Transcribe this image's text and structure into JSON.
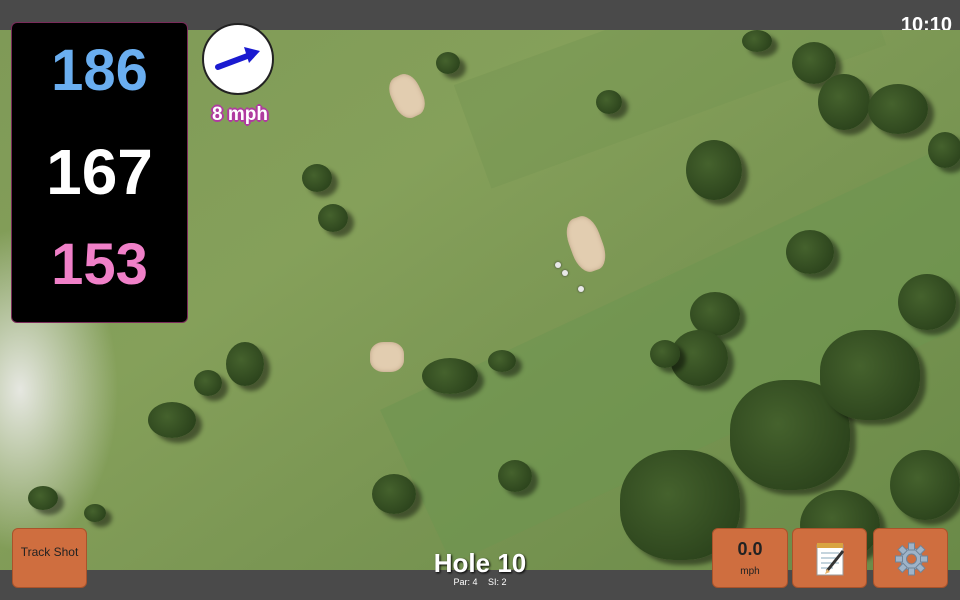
{
  "status_bar": {
    "time": "10:10"
  },
  "distances": {
    "front": "186",
    "center": "167",
    "back": "153",
    "colors": {
      "front": "#6aaef0",
      "center": "#ffffff",
      "back": "#f080c8"
    }
  },
  "wind": {
    "speed_label": "8 mph",
    "direction_icon": "arrow-icon",
    "arrow_color": "#1a1ad0"
  },
  "buttons": {
    "track_shot_label": "Track Shot",
    "speed_value": "0.0",
    "speed_unit": "mph",
    "notes_icon": "notepad-icon",
    "settings_icon": "gear-icon",
    "button_color": "#cf6e3f"
  },
  "hole": {
    "title": "Hole 10",
    "par_label": "Par: 4",
    "si_label": "SI: 2"
  }
}
